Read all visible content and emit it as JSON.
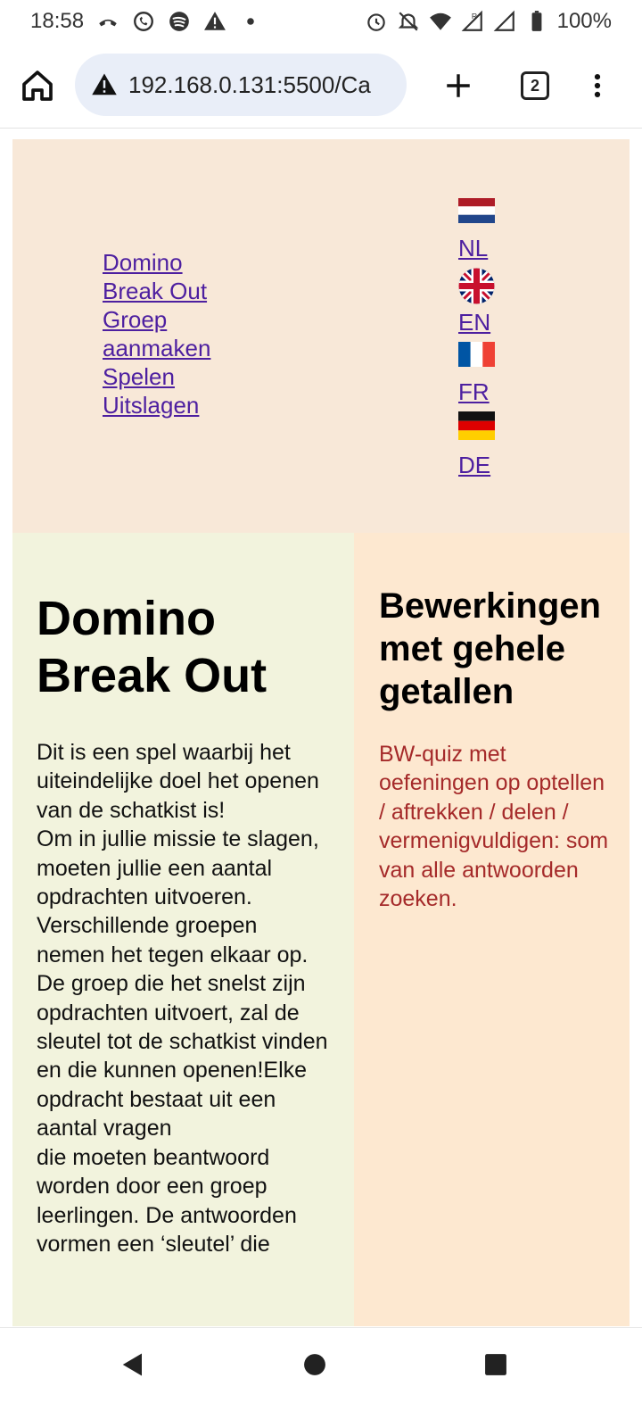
{
  "status_bar": {
    "time": "18:58",
    "battery": "100%"
  },
  "browser": {
    "url": "192.168.0.131:5500/Ca",
    "tab_count": "2"
  },
  "nav": {
    "items": [
      "Domino",
      "Break Out",
      "Groep",
      "aanmaken",
      "Spelen",
      "Uitslagen"
    ]
  },
  "languages": [
    {
      "code": "NL",
      "flag": "nl-flag-icon"
    },
    {
      "code": "EN",
      "flag": "uk-flag-icon"
    },
    {
      "code": "FR",
      "flag": "fr-flag-icon"
    },
    {
      "code": "DE",
      "flag": "de-flag-icon"
    }
  ],
  "main": {
    "title": "Domino Break Out",
    "text": "Dit is een spel waarbij het uiteindelijke doel het openen van de schatkist is!\nOm in jullie missie te slagen, moeten jullie een aantal opdrachten uitvoeren.\nVerschillende groepen nemen het tegen elkaar op. De groep die het snelst zijn opdrachten uitvoert, zal de sleutel tot de schatkist vinden en die kunnen openen!Elke opdracht bestaat uit een aantal vragen\ndie moeten beantwoord worden door een groep leerlingen. De antwoorden vormen een ‘sleutel’ die"
  },
  "side": {
    "title": "Bewerkingen met gehele getallen",
    "text": "BW-quiz met oefeningen op optellen / aftrekken / delen / vermenigvuldigen: som van alle antwoorden zoeken."
  },
  "colors": {
    "header_bg": "#f8e8d8",
    "main_bg": "#f2f3dd",
    "side_bg": "#fde8d0",
    "link": "#4d1fa0",
    "side_text": "#a52a2a"
  }
}
